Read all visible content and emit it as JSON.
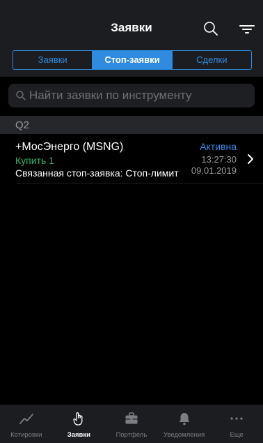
{
  "header": {
    "title": "Заявки",
    "icons": [
      "search-icon",
      "filter-icon"
    ]
  },
  "segments": [
    {
      "label": "Заявки",
      "active": false
    },
    {
      "label": "Стоп-заявки",
      "active": true
    },
    {
      "label": "Сделки",
      "active": false
    }
  ],
  "search": {
    "placeholder": "Найти заявки по инструменту",
    "value": ""
  },
  "section": {
    "title": "Q2"
  },
  "orders": [
    {
      "instrument": "+МосЭнерго (MSNG)",
      "side": "Купить 1",
      "linked": "Связанная стоп-заявка: Стоп-лимит",
      "status": "Активна",
      "time": "13:27:30",
      "date": "09.01.2019"
    }
  ],
  "tabbar": {
    "tabs": [
      {
        "label": "Котировки",
        "icon": "chart-line-icon",
        "active": false
      },
      {
        "label": "Заявки",
        "icon": "hand-pointer-icon",
        "active": true
      },
      {
        "label": "Портфель",
        "icon": "briefcase-icon",
        "active": false
      },
      {
        "label": "Уведомления",
        "icon": "bell-icon",
        "active": false
      },
      {
        "label": "Еще",
        "icon": "more-dots-icon",
        "active": false
      }
    ]
  },
  "colors": {
    "accent": "#2f8be0",
    "buy": "#33b86a",
    "background": "#000000",
    "bar": "#1c1d21",
    "muted": "#9a9ba0"
  }
}
